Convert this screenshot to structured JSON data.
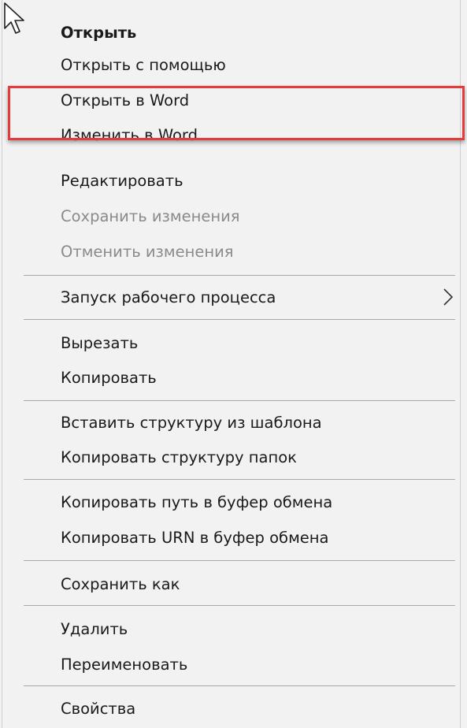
{
  "context_menu": {
    "items": [
      {
        "label": "Открыть"
      },
      {
        "label": "Открыть с помощью"
      },
      {
        "label": "Открыть в Word"
      },
      {
        "label": "Изменить в Word"
      },
      {
        "label": "Редактировать"
      },
      {
        "label": "Сохранить изменения",
        "state": "disabled"
      },
      {
        "label": "Отменить изменения",
        "state": "disabled"
      },
      {
        "label": "Запуск рабочего процесса",
        "submenu_icon": "chevron-right-icon"
      },
      {
        "label": "Вырезать"
      },
      {
        "label": "Копировать"
      },
      {
        "label": "Вставить структуру из шаблона"
      },
      {
        "label": "Копировать структуру папок"
      },
      {
        "label": "Копировать путь в буфер обмена"
      },
      {
        "label": "Копировать URN в буфер обмена"
      },
      {
        "label": "Сохранить как"
      },
      {
        "label": "Удалить"
      },
      {
        "label": "Переименовать"
      },
      {
        "label": "Свойства"
      }
    ]
  },
  "annotation": {
    "highlight_color": "#e53b3b"
  },
  "icons": {
    "cursor": "mouse-pointer-icon",
    "submenu": "chevron-right-icon"
  }
}
